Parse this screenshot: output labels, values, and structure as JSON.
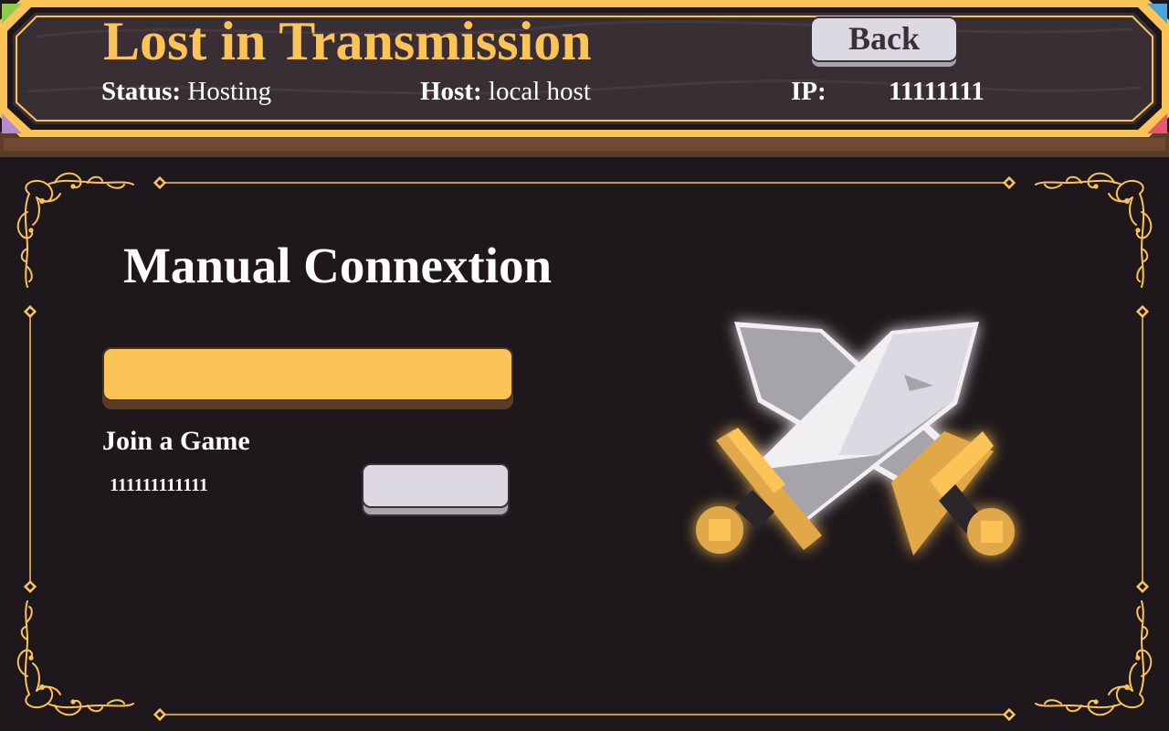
{
  "header": {
    "title": "Lost in Transmission",
    "back_label": "Back",
    "status_label": "Status:",
    "status_value": "Hosting",
    "host_label": "Host:",
    "host_value": "local host",
    "ip_label": "IP:",
    "ip_value": "11111111"
  },
  "panel": {
    "title": "Manual Connextion",
    "ip_input": {
      "value": "",
      "placeholder": ""
    },
    "join_label": "Join a Game",
    "code_text": "111111111111",
    "join_button_label": ""
  },
  "icons": {
    "emblem": "crossed-swords-icon"
  },
  "colors": {
    "background": "#1e171b",
    "header_bg": "#352a30",
    "gold": "#fcc457",
    "button_face": "#dcd9e2",
    "text": "#ffffff"
  }
}
